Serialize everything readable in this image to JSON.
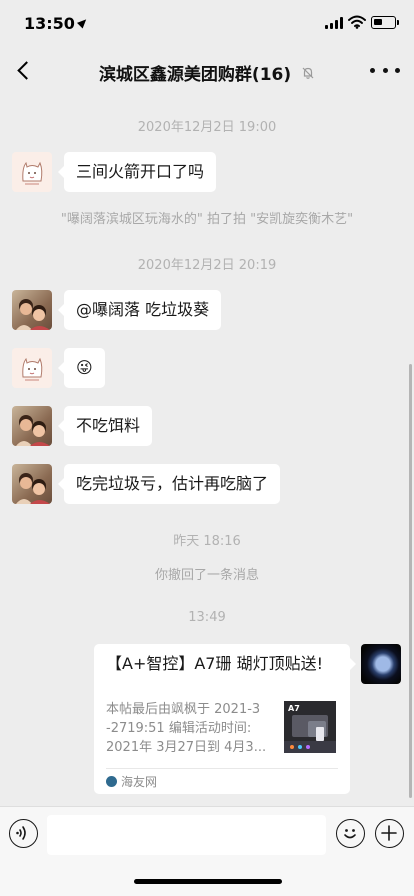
{
  "status": {
    "time": "13:50"
  },
  "header": {
    "title": "滨城区鑫源美团购群(16)"
  },
  "messages": {
    "time_1": "2020年12月2日 19:00",
    "msg_1": "三间火箭开口了吗",
    "pat": "\"嚗阔落滨城区玩海水的\" 拍了拍 \"安凯旋奕衡木艺\"",
    "time_2": "2020年12月2日 20:19",
    "msg_2": "@嚗阔落 吃垃圾葵",
    "msg_3": "😜",
    "msg_4": "不吃饵料",
    "msg_5": "吃完垃圾亏，估计再吃脑了",
    "time_3": "昨天 18:16",
    "recall": "你撤回了一条消息",
    "time_4": "13:49"
  },
  "link_card": {
    "title": "【A+智控】A7珊 瑚灯顶贴送!",
    "desc_lines": [
      "本帖最后由飒枫于 2021-3",
      "-2719:51 编辑活动时间:",
      "2021年 3月27日到 4月3..."
    ],
    "thumb_label": "A7",
    "source": "海友网"
  },
  "input": {
    "placeholder": ""
  },
  "colors": {
    "bubble": "#ffffff",
    "background": "#ededed",
    "input_bar": "#f7f7f7",
    "meta_text": "#b2b2b2"
  },
  "icons": [
    "location-arrow-icon",
    "signal-icon",
    "wifi-icon",
    "battery-icon",
    "back-icon",
    "mute-bell-icon",
    "more-icon",
    "voice-icon",
    "emoji-icon",
    "plus-icon",
    "source-site-icon"
  ]
}
